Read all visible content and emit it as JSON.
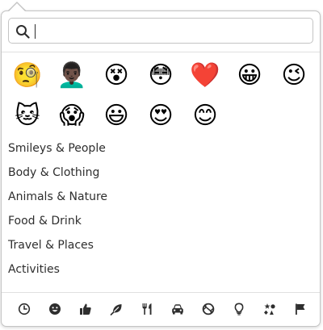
{
  "search": {
    "value": "",
    "placeholder": ""
  },
  "recent_emoji": [
    "🧐",
    "👨🏿‍🦱",
    "😵",
    "😳",
    "❤️",
    "😀",
    "😉",
    "🐱",
    "😱",
    "😃",
    "😍",
    "😊"
  ],
  "categories": [
    {
      "label": "Smileys & People"
    },
    {
      "label": "Body & Clothing"
    },
    {
      "label": "Animals & Nature"
    },
    {
      "label": "Food & Drink"
    },
    {
      "label": "Travel & Places"
    },
    {
      "label": "Activities"
    }
  ],
  "tabs": [
    {
      "icon": "clock-icon"
    },
    {
      "icon": "smiley-icon"
    },
    {
      "icon": "thumbs-up-icon"
    },
    {
      "icon": "leaf-icon"
    },
    {
      "icon": "fork-knife-icon"
    },
    {
      "icon": "car-icon"
    },
    {
      "icon": "ball-icon"
    },
    {
      "icon": "lightbulb-icon"
    },
    {
      "icon": "symbols-icon"
    },
    {
      "icon": "flag-icon"
    }
  ],
  "colors": {
    "border": "#c4c4c4",
    "text": "#2e2e2e",
    "icon": "#2e2e2e"
  }
}
